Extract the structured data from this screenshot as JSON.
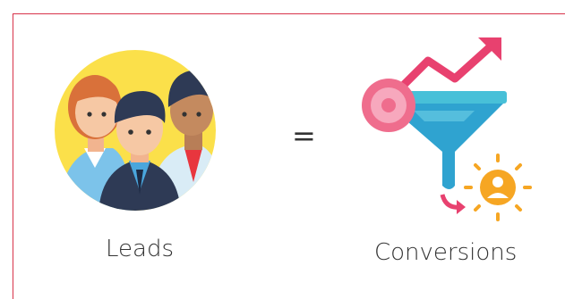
{
  "equation": {
    "left_label": "Leads",
    "operator": "=",
    "right_label": "Conversions"
  },
  "icons": {
    "left": "leads-group-icon",
    "right": "conversion-funnel-icon"
  },
  "colors": {
    "frame": "#d8334a",
    "circle_bg": "#fbe04a",
    "funnel": "#2fa3d0",
    "arrow": "#e8416f",
    "gear": "#ef6d8d",
    "sun": "#f6a623"
  }
}
